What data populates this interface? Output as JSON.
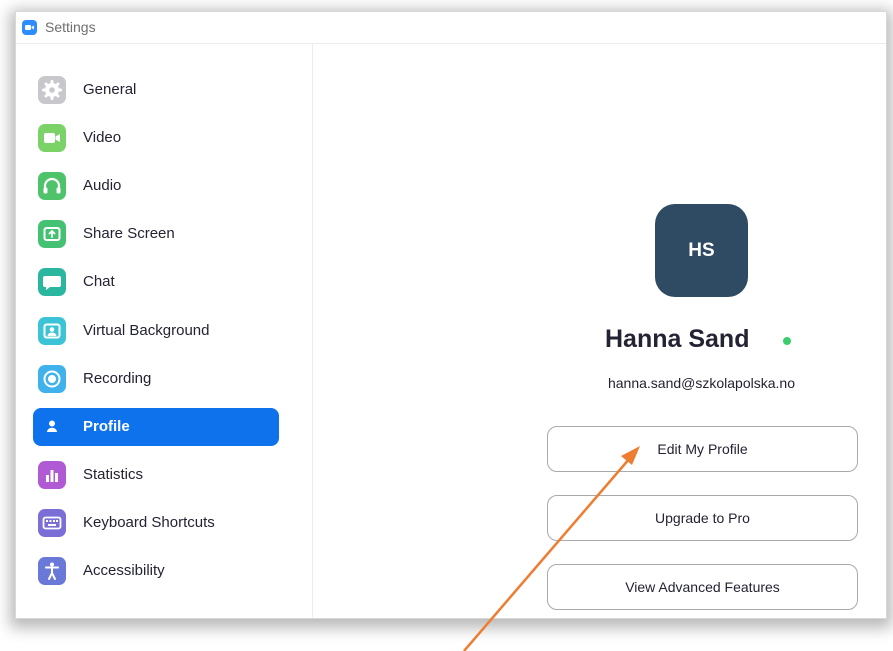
{
  "window": {
    "title": "Settings",
    "app_icon": "video-camera-icon",
    "accent": "#2d8cff"
  },
  "sidebar": {
    "active_color": "#0e72ed",
    "items": [
      {
        "label": "General",
        "icon": "gear-icon",
        "color": "#c8c8cc"
      },
      {
        "label": "Video",
        "icon": "video-camera-icon",
        "color": "#7bd266"
      },
      {
        "label": "Audio",
        "icon": "headphones-icon",
        "color": "#4ec36a"
      },
      {
        "label": "Share Screen",
        "icon": "share-screen-icon",
        "color": "#45c174"
      },
      {
        "label": "Chat",
        "icon": "chat-bubble-icon",
        "color": "#2bb6a0"
      },
      {
        "label": "Virtual Background",
        "icon": "virtual-background-icon",
        "color": "#3cc4d6"
      },
      {
        "label": "Recording",
        "icon": "record-icon",
        "color": "#3fb2ec"
      },
      {
        "label": "Profile",
        "icon": "person-icon",
        "color": "#0e72ed",
        "active": true
      },
      {
        "label": "Statistics",
        "icon": "bar-chart-icon",
        "color": "#b05bd4"
      },
      {
        "label": "Keyboard Shortcuts",
        "icon": "keyboard-icon",
        "color": "#7b6ed6"
      },
      {
        "label": "Accessibility",
        "icon": "accessibility-icon",
        "color": "#6a79d8"
      }
    ]
  },
  "profile": {
    "initials": "HS",
    "avatar_color": "#2f4a63",
    "name": "Hanna Sand",
    "presence": "online",
    "presence_color": "#3dcc6e",
    "email": "hanna.sand@szkolapolska.no",
    "buttons": {
      "edit": "Edit My Profile",
      "upgrade": "Upgrade to Pro",
      "advanced": "View Advanced Features"
    }
  },
  "annotation": {
    "arrow_color": "#ed7d31"
  }
}
